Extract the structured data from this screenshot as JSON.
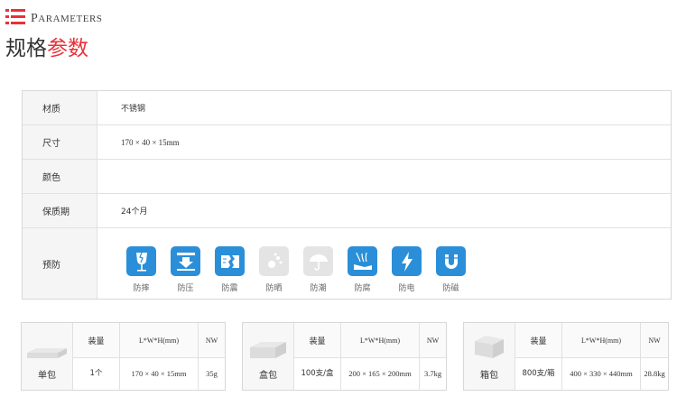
{
  "header": {
    "en_first": "P",
    "en_rest": "ARAMETERS",
    "cn_plain": "规格",
    "cn_accent": "参数"
  },
  "params": [
    {
      "label": "材质",
      "value": "不锈钢"
    },
    {
      "label": "尺寸",
      "value": "170 × 40 × 15mm"
    },
    {
      "label": "颜色",
      "value": ""
    },
    {
      "label": "保质期",
      "value": "24个月"
    },
    {
      "label": "预防",
      "value": ""
    }
  ],
  "protections": [
    {
      "label": "防摔",
      "icon": "fragile-glass-icon",
      "active": true
    },
    {
      "label": "防压",
      "icon": "press-arrow-icon",
      "active": true
    },
    {
      "label": "防震",
      "icon": "shock-crack-icon",
      "active": true
    },
    {
      "label": "防晒",
      "icon": "sun-icon",
      "active": false
    },
    {
      "label": "防潮",
      "icon": "umbrella-icon",
      "active": false
    },
    {
      "label": "防腐",
      "icon": "corrosion-icon",
      "active": true
    },
    {
      "label": "防电",
      "icon": "lightning-icon",
      "active": true
    },
    {
      "label": "防磁",
      "icon": "magnet-icon",
      "active": true
    }
  ],
  "packages": [
    {
      "name": "单包",
      "qty_header": "装量",
      "dim_header": "L*W*H(mm)",
      "nw_header": "NW",
      "qty": "1个",
      "dim": "170 × 40 × 15mm",
      "nw": "35g"
    },
    {
      "name": "盒包",
      "qty_header": "装量",
      "dim_header": "L*W*H(mm)",
      "nw_header": "NW",
      "qty": "100支/盒",
      "dim": "200 × 165 × 200mm",
      "nw": "3.7kg"
    },
    {
      "name": "箱包",
      "qty_header": "装量",
      "dim_header": "L*W*H(mm)",
      "nw_header": "NW",
      "qty": "800支/箱",
      "dim": "400 × 330 × 440mm",
      "nw": "28.8kg"
    }
  ],
  "colors": {
    "accent": "#e8313a",
    "icon_blue": "#2a8fd8",
    "icon_grey": "#e4e4e4"
  }
}
